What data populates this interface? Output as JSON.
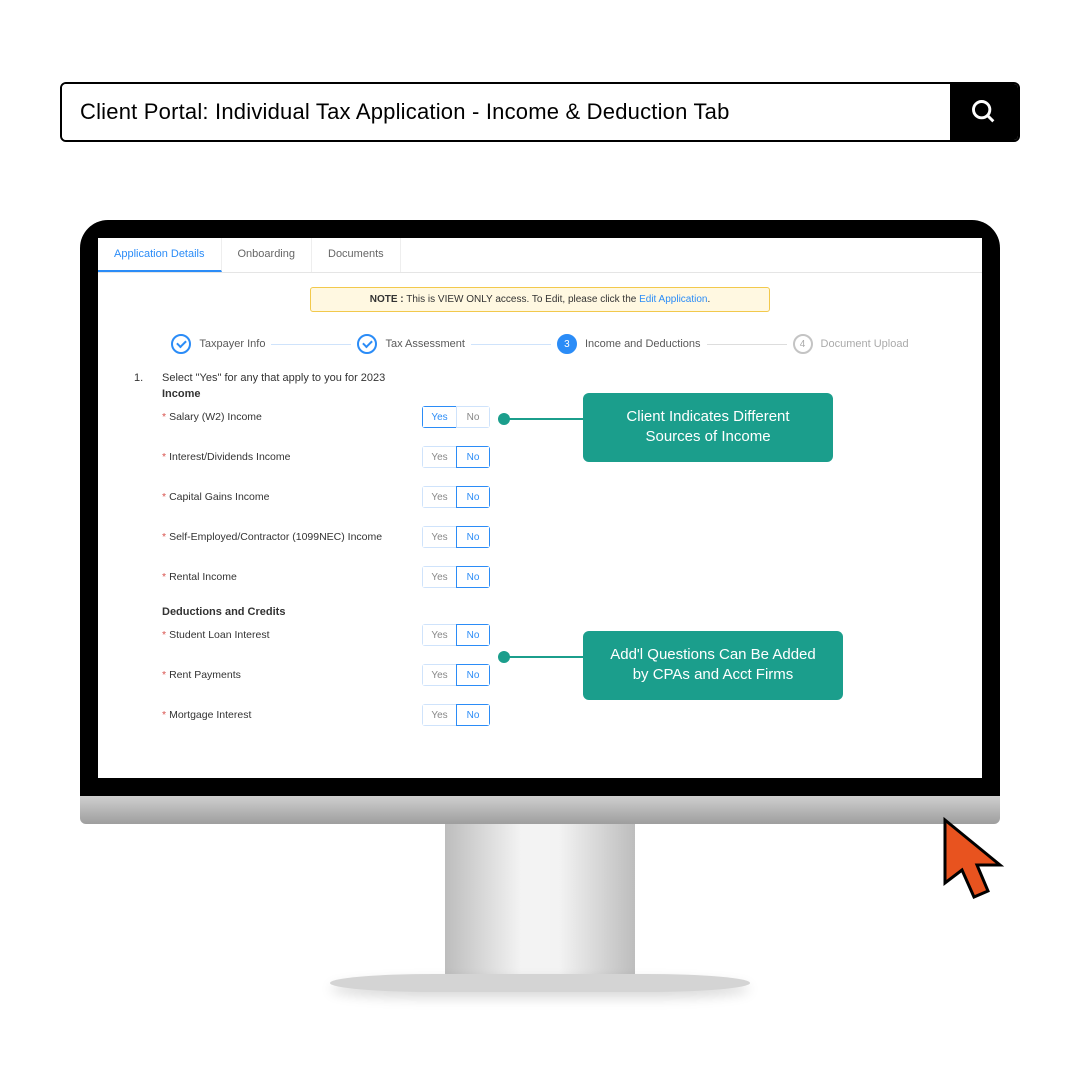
{
  "search": {
    "text": "Client Portal: Individual Tax Application - Income & Deduction Tab"
  },
  "tabs": [
    "Application Details",
    "Onboarding",
    "Documents"
  ],
  "note": {
    "prefix": "NOTE :",
    "body": " This is VIEW ONLY access. To Edit, please click the ",
    "link": "Edit Application"
  },
  "steps": [
    {
      "label": "Taxpayer Info"
    },
    {
      "label": "Tax Assessment"
    },
    {
      "num": "3",
      "label": "Income and Deductions"
    },
    {
      "num": "4",
      "label": "Document Upload"
    }
  ],
  "question": {
    "num": "1.",
    "text": "Select \"Yes\" for any that apply to you for 2023"
  },
  "sections": {
    "income": {
      "title": "Income",
      "rows": [
        {
          "label": "Salary (W2) Income",
          "sel": "yes"
        },
        {
          "label": "Interest/Dividends Income",
          "sel": "no"
        },
        {
          "label": "Capital Gains Income",
          "sel": "no"
        },
        {
          "label": "Self-Employed/Contractor (1099NEC) Income",
          "sel": "no"
        },
        {
          "label": "Rental Income",
          "sel": "no"
        }
      ]
    },
    "deductions": {
      "title": "Deductions and Credits",
      "rows": [
        {
          "label": "Student Loan Interest",
          "sel": "no"
        },
        {
          "label": "Rent Payments",
          "sel": "no"
        },
        {
          "label": "Mortgage Interest",
          "sel": "no"
        }
      ]
    }
  },
  "yn": {
    "yes": "Yes",
    "no": "No"
  },
  "callouts": {
    "c1": "Client Indicates Different Sources of Income",
    "c2": "Add'l Questions Can Be Added by CPAs and Acct Firms"
  }
}
